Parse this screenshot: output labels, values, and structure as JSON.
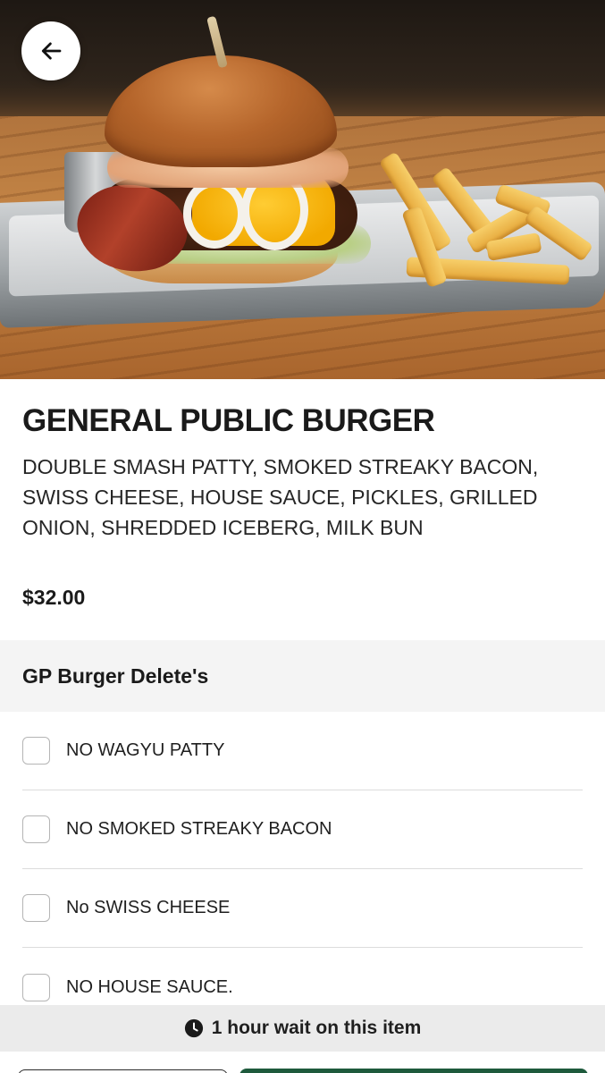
{
  "item": {
    "title": "GENERAL PUBLIC BURGER",
    "description": "DOUBLE SMASH PATTY, SMOKED STREAKY BACON, SWISS CHEESE, HOUSE SAUCE, PICKLES, GRILLED ONION, SHREDDED ICEBERG, MILK BUN",
    "price": "$32.00"
  },
  "section": {
    "title": "GP Burger Delete's"
  },
  "options": [
    {
      "label": "NO WAGYU PATTY",
      "checked": false
    },
    {
      "label": "NO SMOKED STREAKY BACON",
      "checked": false
    },
    {
      "label": "No SWISS CHEESE",
      "checked": false
    },
    {
      "label": "NO HOUSE SAUCE.",
      "checked": false
    }
  ],
  "wait_notice": {
    "icon": "clock-icon",
    "text": "1 hour wait on this item"
  },
  "icons": {
    "back": "arrow-left-icon"
  },
  "colors": {
    "primary_button": "#1e5a3c",
    "section_background": "#f4f4f4",
    "wait_banner_background": "#ebebeb"
  }
}
